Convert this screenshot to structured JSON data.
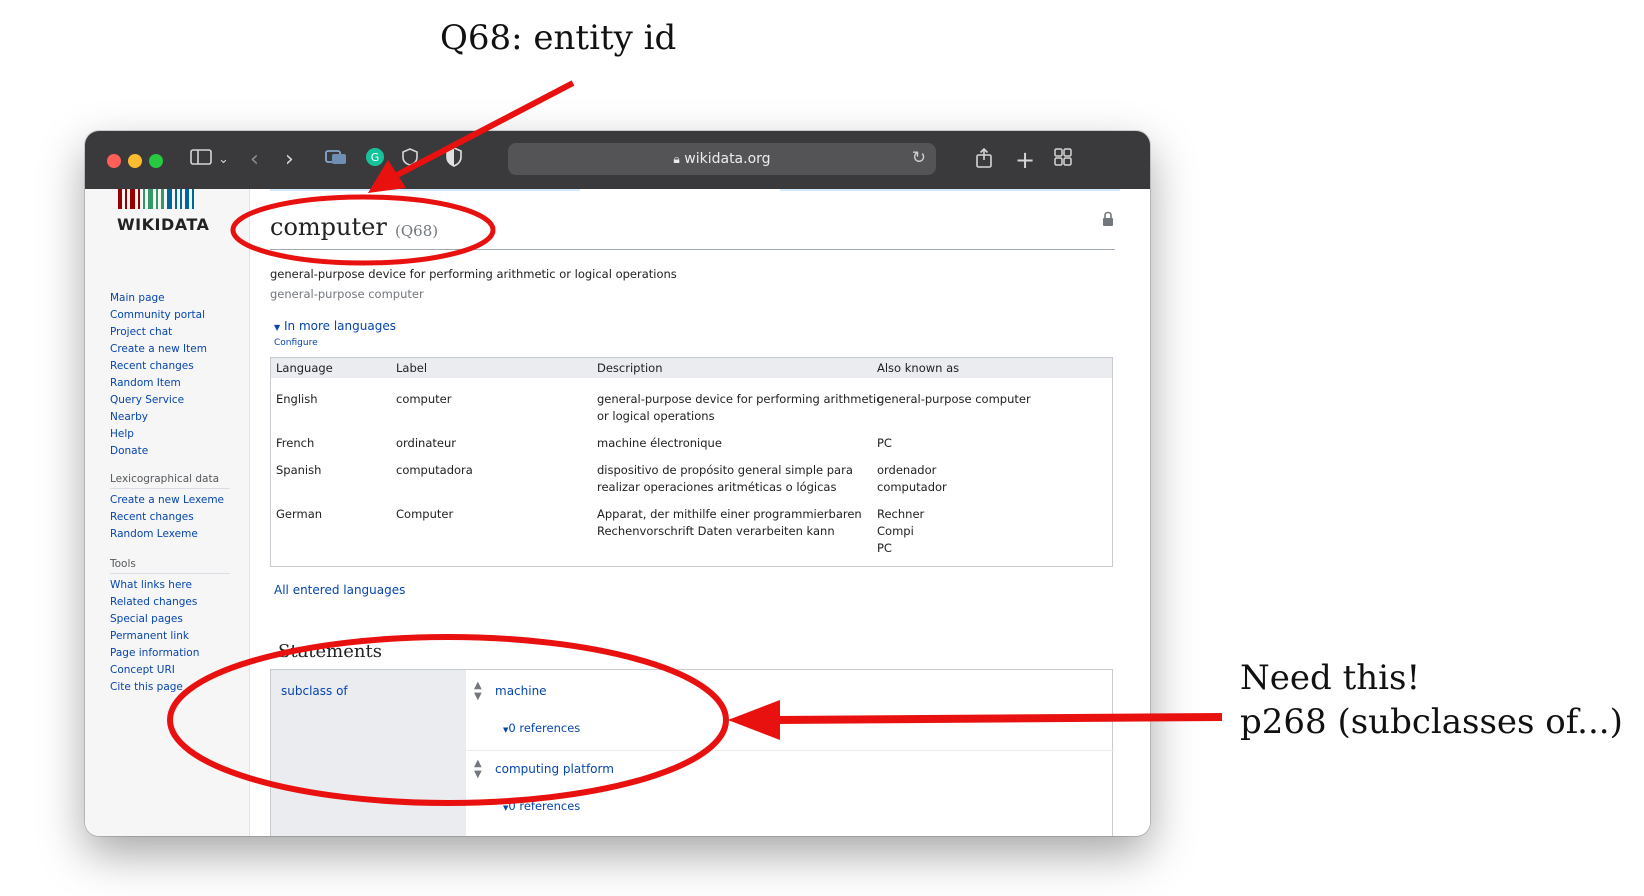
{
  "annotations": {
    "top": "Q68: entity id",
    "right_line1": "Need this!",
    "right_line2": "p268 (subclasses of...)"
  },
  "browser": {
    "address": "wikidata.org",
    "icons": [
      "sidebar-icon",
      "chevron-down-icon",
      "back-icon",
      "forward-icon",
      "tabs-icon",
      "grammarly-icon",
      "shield-icon",
      "privacy-icon",
      "lock-icon",
      "reload-icon",
      "share-icon",
      "new-tab-icon",
      "tab-overview-icon"
    ]
  },
  "sidebar": {
    "logo": "WIKIDATA",
    "logo_colors": [
      "#990000",
      "#339966",
      "#006699"
    ],
    "main": [
      "Main page",
      "Community portal",
      "Project chat",
      "Create a new Item",
      "Recent changes",
      "Random Item",
      "Query Service",
      "Nearby",
      "Help",
      "Donate"
    ],
    "lexico_heading": "Lexicographical data",
    "lexico": [
      "Create a new Lexeme",
      "Recent changes",
      "Random Lexeme"
    ],
    "tools_heading": "Tools",
    "tools": [
      "What links here",
      "Related changes",
      "Special pages",
      "Permanent link",
      "Page information",
      "Concept URI",
      "Cite this page"
    ]
  },
  "item": {
    "title": "computer",
    "id": "(Q68)",
    "description": "general-purpose device for performing arithmetic or logical operations",
    "aliases": "general-purpose computer",
    "more_languages": "In more languages",
    "configure": "Configure",
    "all_languages": "All entered languages"
  },
  "lang_table": {
    "headers": [
      "Language",
      "Label",
      "Description",
      "Also known as"
    ],
    "rows": [
      {
        "language": "English",
        "label": "computer",
        "description": [
          "general-purpose device for performing arithmetic",
          "or logical operations"
        ],
        "aka": [
          "general-purpose computer"
        ]
      },
      {
        "language": "French",
        "label": "ordinateur",
        "description": [
          "machine électronique"
        ],
        "aka": [
          "PC"
        ]
      },
      {
        "language": "Spanish",
        "label": "computadora",
        "description": [
          "dispositivo de propósito general simple para",
          "realizar operaciones aritméticas o lógicas"
        ],
        "aka": [
          "ordenador",
          "computador"
        ]
      },
      {
        "language": "German",
        "label": "Computer",
        "description": [
          "Apparat, der mithilfe einer programmierbaren",
          "Rechenvorschrift Daten verarbeiten kann"
        ],
        "aka": [
          "Rechner",
          "Compi",
          "PC"
        ]
      }
    ]
  },
  "statements": {
    "title": "Statements",
    "property": "subclass of",
    "values": [
      {
        "value": "machine",
        "refs": "0 references"
      },
      {
        "value": "computing platform",
        "refs": "0 references"
      }
    ]
  },
  "colors": {
    "annotation_red": "#e8110f",
    "link": "#0645ad"
  }
}
